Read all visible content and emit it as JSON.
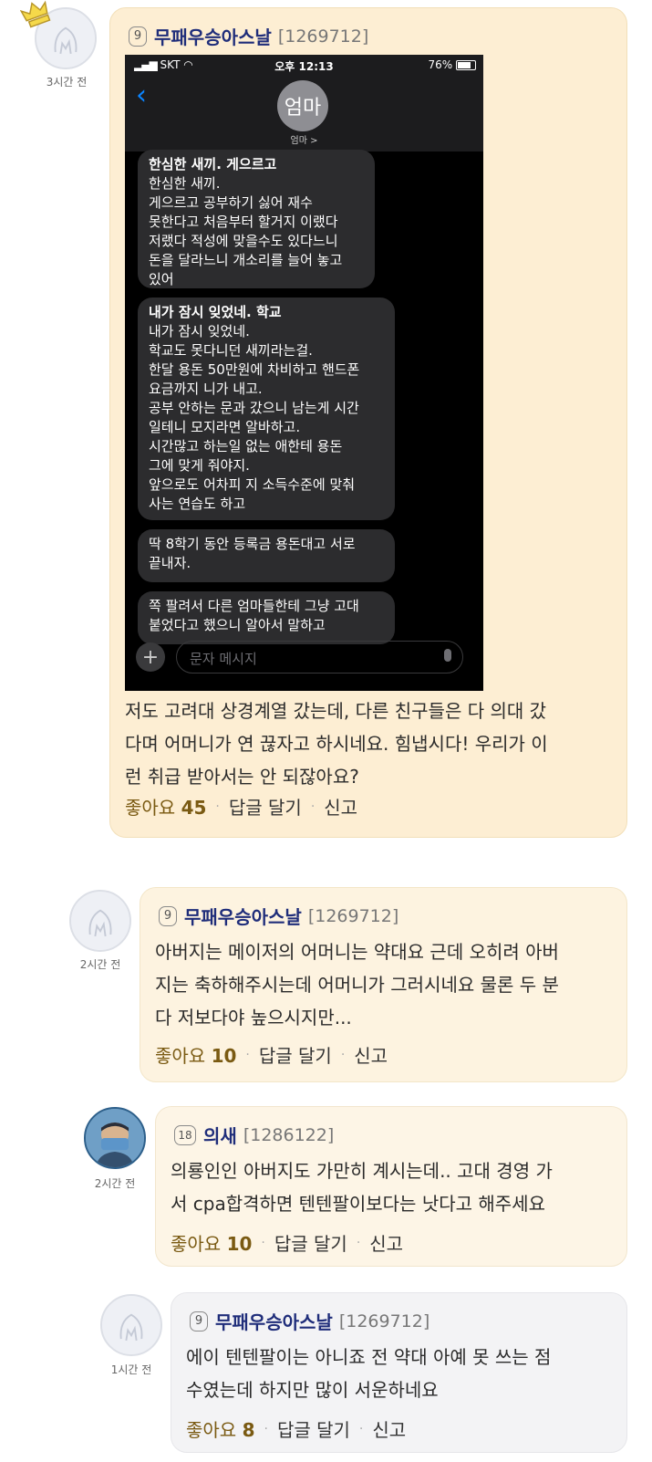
{
  "comments": [
    {
      "level": "9",
      "username": "무패우승아스날",
      "user_id": "[1269712]",
      "time": "3시간 전",
      "text_lines": [
        "저도 고려대 상경계열 갔는데, 다른 친구들은 다 의대 갔",
        "다며 어머니가 연 끊자고 하시네요. 힘냅시다! 우리가 이",
        "런 취급 받아서는 안 되잖아요?"
      ],
      "like_label": "좋아요",
      "like_count": "45",
      "reply_label": "답글 달기",
      "report_label": "신고"
    },
    {
      "level": "9",
      "username": "무패우승아스날",
      "user_id": "[1269712]",
      "time": "2시간 전",
      "text_lines": [
        "아버지는 메이저의 어머니는 약대요 근데 오히려 아버",
        "지는 축하해주시는데 어머니가 그러시네요 물론 두 분",
        "다 저보다야 높으시지만..."
      ],
      "like_label": "좋아요",
      "like_count": "10",
      "reply_label": "답글 달기",
      "report_label": "신고"
    },
    {
      "level": "18",
      "username": "의새",
      "user_id": "[1286122]",
      "time": "2시간 전",
      "text_lines": [
        "의룡인인 아버지도 가만히 계시는데.. 고대 경영 가",
        "서 cpa합격하면 텐텐팔이보다는 낫다고 해주세요"
      ],
      "like_label": "좋아요",
      "like_count": "10",
      "reply_label": "답글 달기",
      "report_label": "신고"
    },
    {
      "level": "9",
      "username": "무패우승아스날",
      "user_id": "[1269712]",
      "time": "1시간 전",
      "text_lines": [
        "에이 텐텐팔이는 아니죠 전 약대 아예 못 쓰는 점",
        "수였는데 하지만 많이 서운하네요"
      ],
      "like_label": "좋아요",
      "like_count": "8",
      "reply_label": "답글 달기",
      "report_label": "신고"
    }
  ],
  "phone": {
    "carrier": "SKT",
    "clock": "오후 12:13",
    "battery": "76%",
    "contact_avatar": "엄마",
    "contact_name": "엄마 >",
    "input_placeholder": "문자 메시지",
    "messages": [
      {
        "title": "한심한 새끼. 게으르고",
        "lines": [
          "한심한 새끼.",
          "게으르고 공부하기 싫어 재수",
          "못한다고 처음부터 할거지 이랬다",
          "저랬다 적성에 맞을수도 있다느니",
          "돈을 달라느니 개소리를 늘어 놓고",
          "있어"
        ]
      },
      {
        "title": "내가 잠시 잊었네. 학교",
        "lines": [
          "내가 잠시 잊었네.",
          "학교도 못다니던 새끼라는걸.",
          "한달 용돈 50만원에 차비하고 핸드폰",
          "요금까지 니가 내고.",
          "공부 안하는 문과 갔으니 남는게 시간",
          "일테니 모지라면 알바하고.",
          "시간많고 하는일 없는 애한테 용돈",
          "그에 맞게 줘야지.",
          "앞으로도 어차피 지 소득수준에 맞춰",
          "사는 연습도 하고"
        ]
      },
      {
        "title": "",
        "lines": [
          "딱 8학기 동안 등록금 용돈대고 서로",
          "끝내자."
        ]
      },
      {
        "title": "",
        "lines": [
          "쪽 팔려서 다른 엄마들한테 그냥 고대",
          "붙었다고 했으니 알아서 말하고"
        ]
      }
    ]
  }
}
